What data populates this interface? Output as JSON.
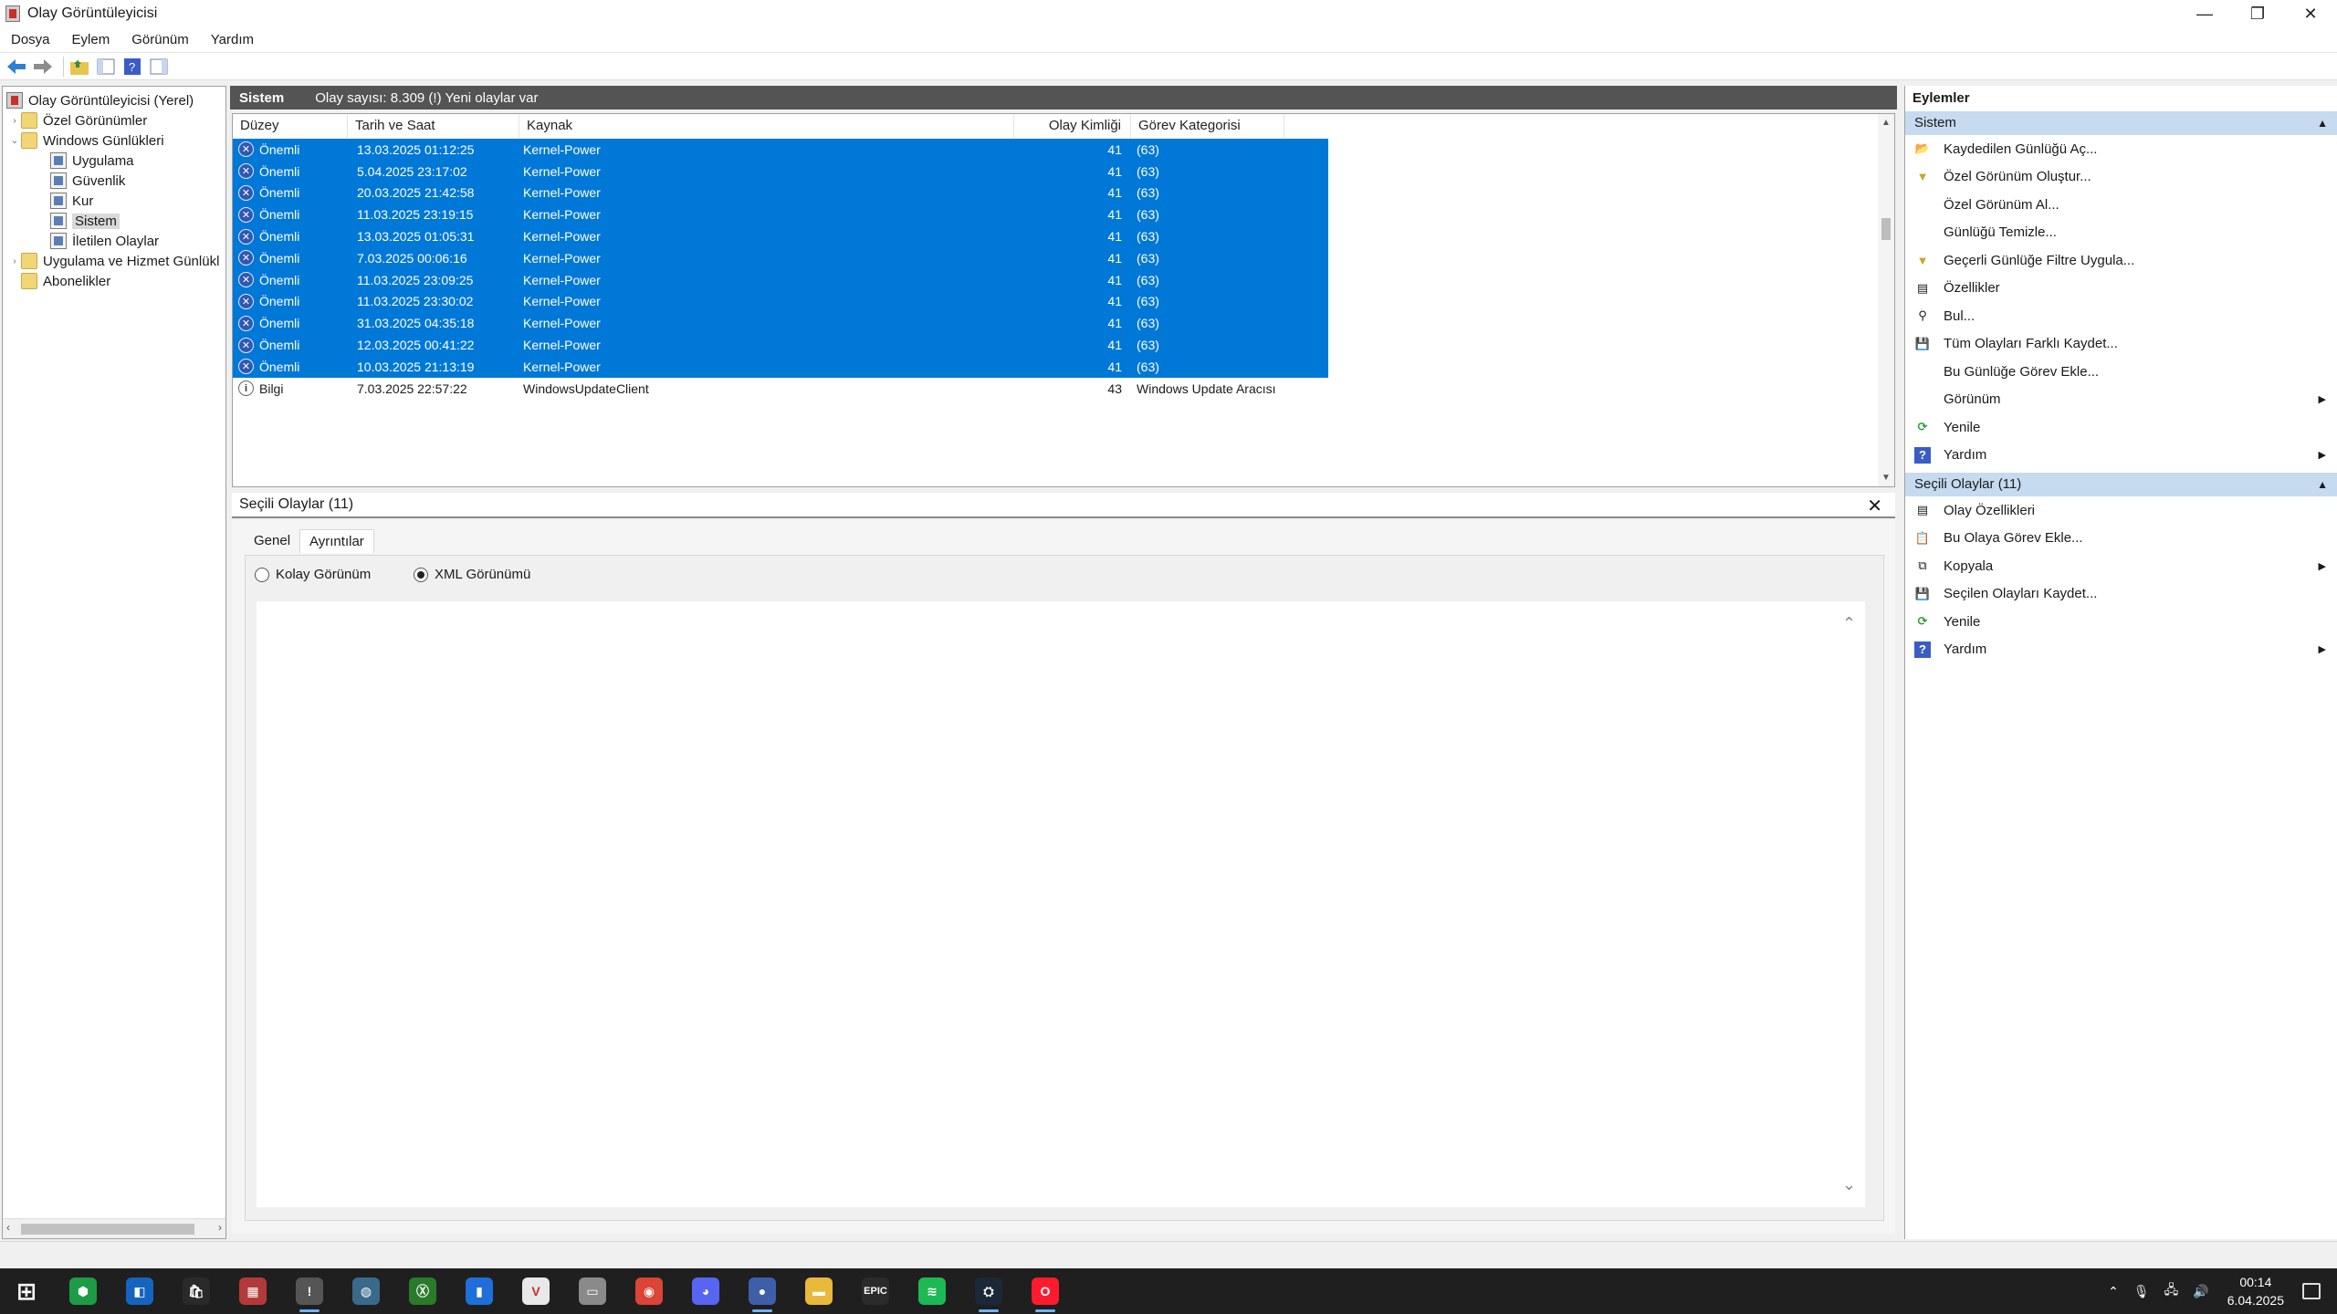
{
  "window": {
    "title": "Olay Görüntüleyicisi",
    "minimize": "—",
    "restore": "❐",
    "close": "✕"
  },
  "menu": [
    "Dosya",
    "Eylem",
    "Görünüm",
    "Yardım"
  ],
  "tree": {
    "root": "Olay Görüntüleyicisi (Yerel)",
    "custom_views": "Özel Görünümler",
    "windows_logs": "Windows Günlükleri",
    "logs": [
      "Uygulama",
      "Güvenlik",
      "Kur",
      "Sistem",
      "İletilen Olaylar"
    ],
    "app_service_logs": "Uygulama ve Hizmet Günlükl",
    "subscriptions": "Abonelikler"
  },
  "log_header": {
    "name": "Sistem",
    "info": "Olay sayısı: 8.309 (!) Yeni olaylar var"
  },
  "grid": {
    "columns": [
      "Düzey",
      "Tarih ve Saat",
      "Kaynak",
      "Olay Kimliği",
      "Görev Kategorisi"
    ],
    "rows": [
      {
        "level": "Önemli",
        "datetime": "13.03.2025 01:12:25",
        "source": "Kernel-Power",
        "id": "41",
        "category": "(63)"
      },
      {
        "level": "Önemli",
        "datetime": "5.04.2025 23:17:02",
        "source": "Kernel-Power",
        "id": "41",
        "category": "(63)"
      },
      {
        "level": "Önemli",
        "datetime": "20.03.2025 21:42:58",
        "source": "Kernel-Power",
        "id": "41",
        "category": "(63)"
      },
      {
        "level": "Önemli",
        "datetime": "11.03.2025 23:19:15",
        "source": "Kernel-Power",
        "id": "41",
        "category": "(63)"
      },
      {
        "level": "Önemli",
        "datetime": "13.03.2025 01:05:31",
        "source": "Kernel-Power",
        "id": "41",
        "category": "(63)"
      },
      {
        "level": "Önemli",
        "datetime": "7.03.2025 00:06:16",
        "source": "Kernel-Power",
        "id": "41",
        "category": "(63)"
      },
      {
        "level": "Önemli",
        "datetime": "11.03.2025 23:09:25",
        "source": "Kernel-Power",
        "id": "41",
        "category": "(63)"
      },
      {
        "level": "Önemli",
        "datetime": "11.03.2025 23:30:02",
        "source": "Kernel-Power",
        "id": "41",
        "category": "(63)"
      },
      {
        "level": "Önemli",
        "datetime": "31.03.2025 04:35:18",
        "source": "Kernel-Power",
        "id": "41",
        "category": "(63)"
      },
      {
        "level": "Önemli",
        "datetime": "12.03.2025 00:41:22",
        "source": "Kernel-Power",
        "id": "41",
        "category": "(63)"
      },
      {
        "level": "Önemli",
        "datetime": "10.03.2025 21:13:19",
        "source": "Kernel-Power",
        "id": "41",
        "category": "(63)"
      },
      {
        "level": "Bilgi",
        "datetime": "7.03.2025 22:57:22",
        "source": "WindowsUpdateClient",
        "id": "43",
        "category": "Windows Update Aracısı"
      }
    ]
  },
  "details": {
    "title": "Seçili Olaylar (11)",
    "close": "✕",
    "tabs": [
      "Genel",
      "Ayrıntılar"
    ],
    "radio_friendly": "Kolay Görünüm",
    "radio_xml": "XML Görünümü"
  },
  "actions": {
    "title": "Eylemler",
    "section1": "Sistem",
    "items1": [
      "Kaydedilen Günlüğü Aç...",
      "Özel Görünüm Oluştur...",
      "Özel Görünüm Al...",
      "Günlüğü Temizle...",
      "Geçerli Günlüğe Filtre Uygula...",
      "Özellikler",
      "Bul...",
      "Tüm Olayları Farklı Kaydet...",
      "Bu Günlüğe Görev Ekle...",
      "Görünüm",
      "Yenile",
      "Yardım"
    ],
    "section2": "Seçili Olaylar (11)",
    "items2": [
      "Olay Özellikleri",
      "Bu Olaya Görev Ekle...",
      "Kopyala",
      "Seçilen Olayları Kaydet...",
      "Yenile",
      "Yardım"
    ]
  },
  "taskbar": {
    "apps": [
      "start-icon",
      "xbox-green-icon",
      "blue-app-icon",
      "store-icon",
      "calendar-icon",
      "event-viewer-icon",
      "globe-icon",
      "xbox-icon",
      "taskmanager-icon",
      "riot-icon",
      "files-icon",
      "chrome-icon",
      "discord-icon",
      "blue-circle-icon",
      "explorer-icon",
      "epic-games-icon",
      "spotify-icon",
      "steam-icon",
      "opera-icon"
    ],
    "epic_label": "EPIC",
    "time": "00:14",
    "date": "6.04.2025"
  },
  "colors": {
    "selection": "#0078d7",
    "header": "#545454",
    "section": "#c6daf0",
    "taskbar": "#1f1f1f"
  }
}
